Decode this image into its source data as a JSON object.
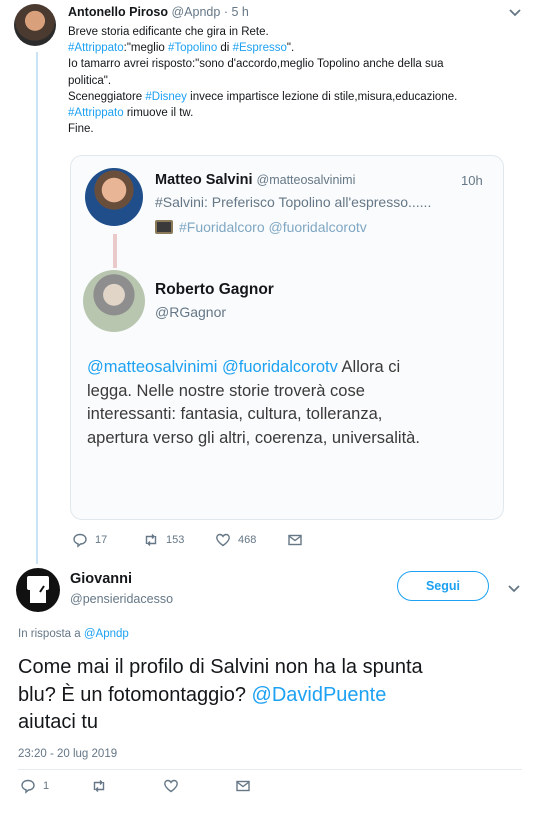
{
  "tweet1": {
    "name": "Antonello Piroso",
    "handle": "@Apndp",
    "time": "· 5 h",
    "lines": [
      [
        {
          "t": "Breve storia edificante che gira in Rete."
        }
      ],
      [
        {
          "t": "#Attrippato",
          "l": true
        },
        {
          "t": ":\"meglio "
        },
        {
          "t": "#Topolino",
          "l": true
        },
        {
          "t": " di "
        },
        {
          "t": "#Espresso",
          "l": true
        },
        {
          "t": "\"."
        }
      ],
      [
        {
          "t": "Io tamarro avrei risposto:\"sono d'accordo,meglio Topolino anche della sua"
        }
      ],
      [
        {
          "t": "politica\"."
        }
      ],
      [
        {
          "t": "Sceneggiatore "
        },
        {
          "t": "#Disney",
          "l": true
        },
        {
          "t": " invece impartisce lezione di stile,misura,educazione."
        }
      ],
      [
        {
          "t": "#Attrippato",
          "l": true
        },
        {
          "t": " rimuove il tw."
        }
      ],
      [
        {
          "t": "Fine."
        }
      ]
    ],
    "card": {
      "ms_name": "Matteo Salvini",
      "ms_handle": "@matteosalvinimi",
      "ms_time": "10h",
      "ms_line1": "#Salvini: Preferisco Topolino all'espresso......",
      "ms_line2": "#Fuoridalcoro @fuoridalcorotv",
      "rg_name": "Roberto Gagnor",
      "rg_handle": "@RGagnor",
      "rg_lines": [
        [
          {
            "t": "@matteosalvinimi @fuoridalcorotv",
            "l": true
          },
          {
            "t": " Allora ci"
          }
        ],
        [
          {
            "t": "legga. Nelle nostre storie troverà cose"
          }
        ],
        [
          {
            "t": "interessanti: fantasia, cultura, tolleranza,"
          }
        ],
        [
          {
            "t": "apertura verso gli altri, coerenza, universalità."
          }
        ]
      ]
    },
    "actions": {
      "replies": "17",
      "retweets": "153",
      "likes": "468"
    }
  },
  "tweet2": {
    "name": "Giovanni",
    "handle": "@pensieridacesso",
    "follow_label": "Segui",
    "reply_prefix": "In risposta a",
    "reply_handle": "@Apndp",
    "lines": [
      [
        {
          "t": "Come mai il profilo di Salvini non ha la spunta"
        }
      ],
      [
        {
          "t": "blu? È un fotomontaggio? "
        },
        {
          "t": "@DavidPuente",
          "l": true
        }
      ],
      [
        {
          "t": "aiutaci tu"
        }
      ]
    ],
    "timestamp": "23:20 - 20 lug 2019",
    "actions": {
      "replies": "1"
    }
  },
  "colors": {
    "link": "#1da1f2",
    "muted": "#657786",
    "text": "#14171a"
  }
}
